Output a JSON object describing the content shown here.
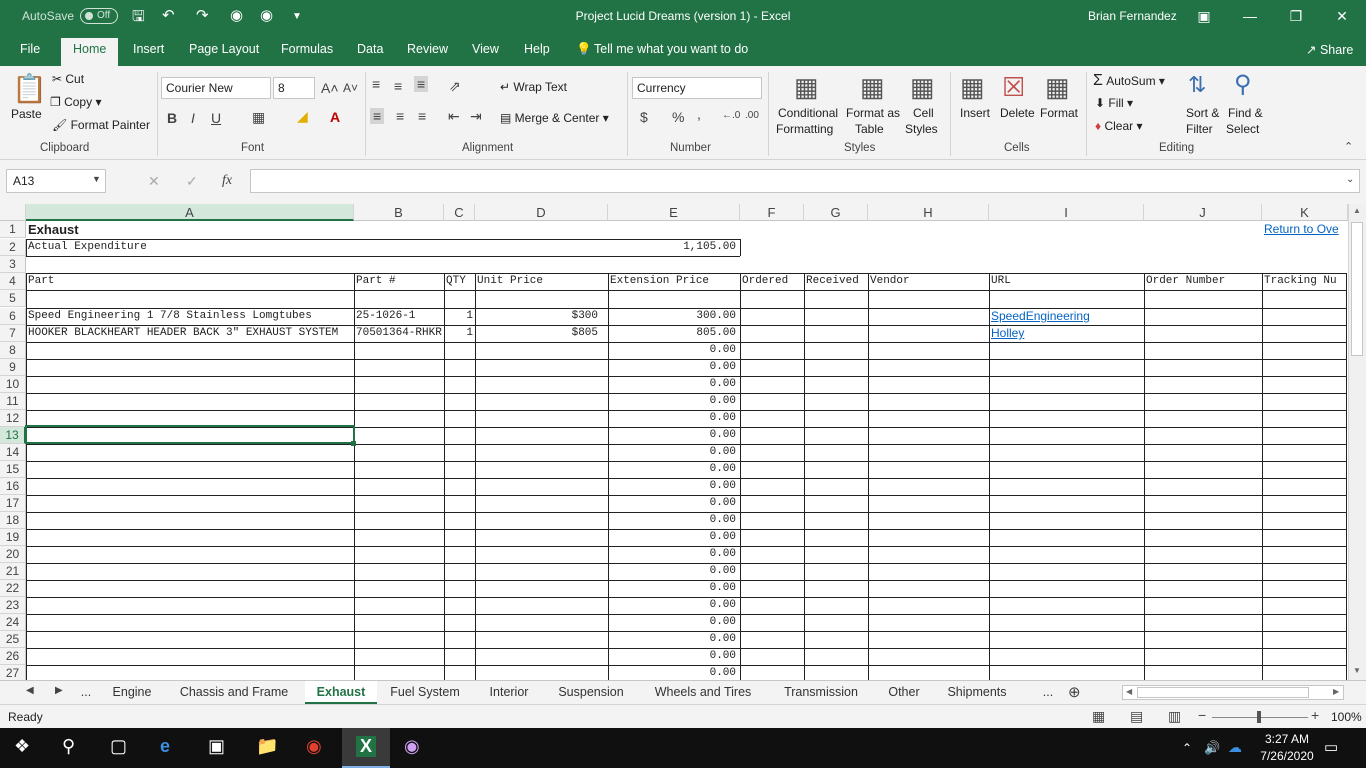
{
  "titlebar": {
    "autosave": "AutoSave",
    "autosave_state": "Off",
    "title": "Project Lucid Dreams (version 1)  -  Excel",
    "user": "Brian Fernandez"
  },
  "menu": [
    "File",
    "Home",
    "Insert",
    "Page Layout",
    "Formulas",
    "Data",
    "Review",
    "View",
    "Help"
  ],
  "tell_me": "Tell me what you want to do",
  "share": "Share",
  "ribbon": {
    "clipboard": {
      "label": "Clipboard",
      "paste": "Paste",
      "cut": "Cut",
      "copy": "Copy",
      "format_painter": "Format Painter"
    },
    "font": {
      "label": "Font",
      "family": "Courier New",
      "size": "8"
    },
    "alignment": {
      "label": "Alignment",
      "wrap": "Wrap Text",
      "merge": "Merge & Center"
    },
    "number": {
      "label": "Number",
      "format": "Currency",
      "dollar": "$",
      "percent": "%",
      "comma": ","
    },
    "styles": {
      "label": "Styles",
      "conditional": "Conditional",
      "conditional2": "Formatting",
      "format_as": "Format as",
      "format_as2": "Table",
      "cell": "Cell",
      "cell2": "Styles"
    },
    "cells": {
      "label": "Cells",
      "insert": "Insert",
      "delete": "Delete",
      "format": "Format"
    },
    "editing": {
      "label": "Editing",
      "autosum": "AutoSum",
      "fill": "Fill",
      "clear": "Clear",
      "sort": "Sort &",
      "sort2": "Filter",
      "find": "Find &",
      "find2": "Select"
    }
  },
  "formula_bar": {
    "name_box": "A13",
    "fx": "fx",
    "content": ""
  },
  "columns": [
    "A",
    "B",
    "C",
    "D",
    "E",
    "F",
    "G",
    "H",
    "I",
    "J",
    "K"
  ],
  "rows": [
    "1",
    "2",
    "3",
    "4",
    "5",
    "6",
    "7",
    "8",
    "9",
    "10",
    "11",
    "12",
    "13",
    "14",
    "15",
    "16",
    "17",
    "18",
    "19",
    "20",
    "21",
    "22",
    "23",
    "24",
    "25",
    "26",
    "27"
  ],
  "sheet": {
    "title": "Exhaust",
    "return_link": "Return to Ove",
    "actual_label": "Actual Expenditure",
    "actual_value": "1,105.00",
    "headers": [
      "Part",
      "Part #",
      "QTY",
      "Unit Price",
      "Extension Price",
      "Ordered",
      "Received",
      "Vendor",
      "URL",
      "Order Number",
      "Tracking Nu"
    ],
    "items": [
      {
        "part": "Speed Engineering 1 7/8 Stainless Lomgtubes",
        "partno": "25-1026-1",
        "qty": "1",
        "unit": "$300",
        "ext": "300.00",
        "url": "SpeedEngineering"
      },
      {
        "part": "HOOKER BLACKHEART HEADER BACK 3\" EXHAUST SYSTEM",
        "partno": "70501364-RHKR",
        "qty": "1",
        "unit": "$805",
        "ext": "805.00",
        "url": "Holley"
      }
    ],
    "empty_ext": "0.00"
  },
  "tabs": [
    "Engine",
    "Chassis and Frame",
    "Exhaust",
    "Fuel System",
    "Interior",
    "Suspension",
    "Wheels and Tires",
    "Transmission",
    "Other",
    "Shipments"
  ],
  "tabs_more": "...",
  "status": {
    "ready": "Ready",
    "zoom": "100%"
  },
  "taskbar": {
    "time": "3:27 AM",
    "date": "7/26/2020"
  }
}
